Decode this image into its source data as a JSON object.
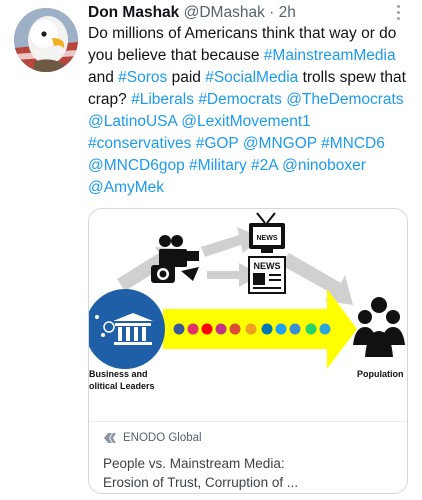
{
  "tweet": {
    "author_name": "Don Mashak",
    "author_handle": "@DMashak",
    "separator": "·",
    "time": "2h",
    "segments": [
      {
        "t": "Do millions of Americans think that way or do you believe that because ",
        "link": false
      },
      {
        "t": "#MainstreamMedia",
        "link": true
      },
      {
        "t": " and ",
        "link": false
      },
      {
        "t": "#Soros",
        "link": true
      },
      {
        "t": " paid ",
        "link": false
      },
      {
        "t": "#SocialMedia",
        "link": true
      },
      {
        "t": " trolls spew that crap? ",
        "link": false
      },
      {
        "t": "#Liberals",
        "link": true
      },
      {
        "t": " ",
        "link": false
      },
      {
        "t": "#Democrats",
        "link": true
      },
      {
        "t": " ",
        "link": false
      },
      {
        "t": "@TheDemocrats",
        "link": true
      },
      {
        "t": " ",
        "link": false
      },
      {
        "t": "@LatinoUSA",
        "link": true
      },
      {
        "t": " ",
        "link": false
      },
      {
        "t": "@LexitMovement1",
        "link": true
      },
      {
        "t": " ",
        "link": false
      },
      {
        "t": "#conservatives",
        "link": true
      },
      {
        "t": " ",
        "link": false
      },
      {
        "t": "#GOP",
        "link": true
      },
      {
        "t": " ",
        "link": false
      },
      {
        "t": "@MNGOP",
        "link": true
      },
      {
        "t": " ",
        "link": false
      },
      {
        "t": "#MNCD6",
        "link": true
      },
      {
        "t": " ",
        "link": false
      },
      {
        "t": "@MNCD6gop",
        "link": true
      },
      {
        "t": " ",
        "link": false
      },
      {
        "t": "#Military",
        "link": true
      },
      {
        "t": " ",
        "link": false
      },
      {
        "t": "#2A",
        "link": true
      },
      {
        "t": "  ",
        "link": false
      },
      {
        "t": "@ninoboxer",
        "link": true
      },
      {
        "t": " ",
        "link": false
      },
      {
        "t": "@AmyMek",
        "link": true
      }
    ]
  },
  "card": {
    "image_labels": {
      "left": "Business and\nolitical Leaders",
      "right": "Population",
      "news": "NEWS",
      "tv": "NEWS"
    },
    "domain": "ENODO Global",
    "title_line1": "People vs. Mainstream Media:",
    "title_line2": "Erosion of Trust, Corruption of ..."
  },
  "colors": {
    "link": "#1d9bf0",
    "arrow_yellow": "#ffff00",
    "circle_blue": "#1f5fa8",
    "arrow_gray": "#d0d0d0"
  },
  "icons": [
    "more-icon",
    "eagle-avatar",
    "camera-icon",
    "tv-icon",
    "newspaper-icon",
    "bank-icon",
    "people-icon",
    "social-icons",
    "enodo-logo-icon"
  ]
}
